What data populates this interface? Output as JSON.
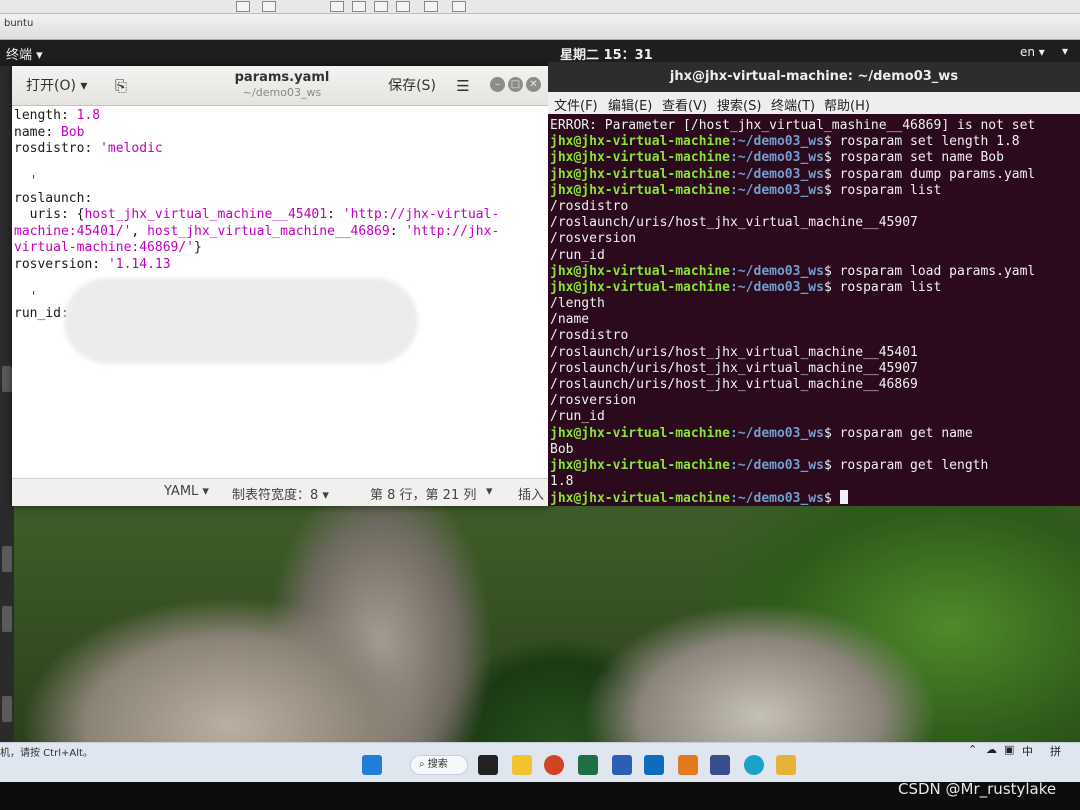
{
  "topbar": {
    "activities": "终端 ▾",
    "clock": "星期二 15：31",
    "lang": "en ▾",
    "sys": "▾"
  },
  "vm": {
    "tab": "buntu"
  },
  "gedit": {
    "open_label": "打开(O) ▾",
    "title": "params.yaml",
    "path": "~/demo03_ws",
    "save_label": "保存(S)",
    "menu_label": "☰",
    "lines": [
      [
        [
          "length",
          "k"
        ],
        [
          ": ",
          "k"
        ],
        [
          "1.8",
          "v"
        ]
      ],
      [
        [
          "name",
          "k"
        ],
        [
          ": ",
          "k"
        ],
        [
          "Bob",
          "v"
        ]
      ],
      [
        [
          "rosdistro",
          "k"
        ],
        [
          ": ",
          "k"
        ],
        [
          "'melodic",
          "v"
        ]
      ],
      [
        [
          "",
          "k"
        ]
      ],
      [
        [
          "  '",
          "v"
        ]
      ],
      [
        [
          "roslaunch",
          "k"
        ],
        [
          ":",
          "k"
        ]
      ],
      [
        [
          "  uris",
          "k"
        ],
        [
          ": {",
          "k"
        ],
        [
          "host_jhx_virtual_machine__45401",
          "v"
        ],
        [
          ": ",
          "k"
        ],
        [
          "'http://jhx-virtual-",
          "v"
        ]
      ],
      [
        [
          "machine:45401/'",
          "v"
        ],
        [
          ", ",
          "k"
        ],
        [
          "host_jhx_virtual_machine__46869",
          "v"
        ],
        [
          ": ",
          "k"
        ],
        [
          "'http://jhx-",
          "v"
        ]
      ],
      [
        [
          "virtual-machine:46869/'",
          "v"
        ],
        [
          "}",
          "k"
        ]
      ],
      [
        [
          "rosversion",
          "k"
        ],
        [
          ": ",
          "k"
        ],
        [
          "'1.14.13",
          "v"
        ]
      ],
      [
        [
          "",
          "k"
        ]
      ],
      [
        [
          "  '",
          "v"
        ]
      ],
      [
        [
          "run_id",
          "k"
        ],
        [
          ":",
          "k"
        ]
      ]
    ],
    "status": {
      "lang": "YAML ▾",
      "tab": "制表符宽度：8 ▾",
      "pos": "第 8 行，第 21 列",
      "pos_arrow": "▾",
      "mode": "插入"
    }
  },
  "terminal": {
    "title": "jhx@jhx-virtual-machine: ~/demo03_ws",
    "menu": [
      "文件(F)",
      "编辑(E)",
      "查看(V)",
      "搜索(S)",
      "终端(T)",
      "帮助(H)"
    ],
    "user": "jhx@jhx-virtual-machine",
    "path": ":~/demo03_ws",
    "lines": [
      {
        "out": "ERROR: Parameter [/host_jhx_virtual_mashine__46869] is not set"
      },
      {
        "cmd": " rosparam set length 1.8"
      },
      {
        "cmd": " rosparam set name Bob"
      },
      {
        "cmd": " rosparam dump params.yaml"
      },
      {
        "cmd": " rosparam list"
      },
      {
        "out": "/rosdistro"
      },
      {
        "out": "/roslaunch/uris/host_jhx_virtual_machine__45907"
      },
      {
        "out": "/rosversion"
      },
      {
        "out": "/run_id"
      },
      {
        "cmd": " rosparam load params.yaml"
      },
      {
        "cmd": " rosparam list"
      },
      {
        "out": "/length"
      },
      {
        "out": "/name"
      },
      {
        "out": "/rosdistro"
      },
      {
        "out": "/roslaunch/uris/host_jhx_virtual_machine__45401"
      },
      {
        "out": "/roslaunch/uris/host_jhx_virtual_machine__45907"
      },
      {
        "out": "/roslaunch/uris/host_jhx_virtual_machine__46869"
      },
      {
        "out": "/rosversion"
      },
      {
        "out": "/run_id"
      },
      {
        "cmd": " rosparam get name"
      },
      {
        "out": "Bob"
      },
      {
        "cmd": " rosparam get length"
      },
      {
        "out": "1.8"
      },
      {
        "cmd": " ",
        "cursor": true
      }
    ]
  },
  "taskbar": {
    "hint": "机，请按 Ctrl+Alt。",
    "search": "搜索",
    "tray_ime": "中",
    "tray_ime2": "拼"
  },
  "watermark": "CSDN @Mr_rustylake",
  "colors": {
    "terminal_bg": "#2c0a1e",
    "prompt_user": "#8ae234",
    "prompt_path": "#729fcf",
    "yaml_value": "#c000c0"
  }
}
